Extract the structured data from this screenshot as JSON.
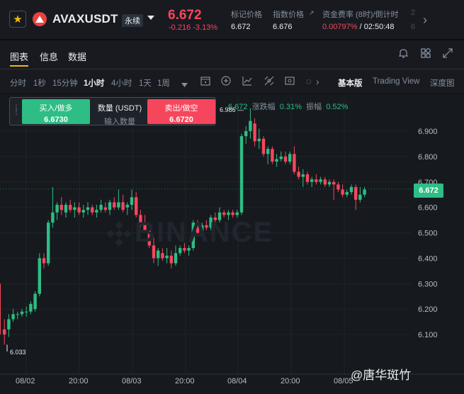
{
  "header": {
    "symbol": "AVAXUSDT",
    "contract_tag": "永续",
    "price": "6.672",
    "change": "-0.216 -3.13%",
    "mark_price_label": "标记价格",
    "mark_price": "6.672",
    "index_price_label": "指数价格",
    "index_price": "6.676",
    "funding_label": "资金费率 (8时)/倒计时",
    "funding_rate": "0.00797%",
    "countdown": "/ 02:50:48",
    "cut_label": "2",
    "cut_value": "6",
    "star_icon": "star-icon",
    "next_icon": "chevron-right-icon"
  },
  "tabs": {
    "chart": "图表",
    "info": "信息",
    "data": "数据"
  },
  "intervals": [
    "分时",
    "1秒",
    "15分钟",
    "1小时",
    "4小时",
    "1天",
    "1周"
  ],
  "active_interval": "1小时",
  "views": {
    "basic": "基本版",
    "trading_view": "Trading View",
    "depth": "深度图"
  },
  "order_widget": {
    "buy_label": "买入/做多",
    "buy_price": "6.6730",
    "qty_label": "数量 (USDT)",
    "qty_placeholder": "输入数量",
    "sell_label": "卖出/做空",
    "sell_price": "6.6720"
  },
  "legend": {
    "close": "6.672",
    "change_label": "涨跌幅",
    "change_value": "0.31%",
    "amp_label": "振幅",
    "amp_value": "0.52%"
  },
  "chart_data": {
    "type": "candlestick",
    "x_labels": [
      "08/02",
      "20:00",
      "08/03",
      "20:00",
      "08/04",
      "20:00",
      "08/05"
    ],
    "y_ticks": [
      "6.900",
      "6.800",
      "6.700",
      "6.600",
      "6.500",
      "6.400",
      "6.300",
      "6.200",
      "6.100"
    ],
    "ylim": [
      6.02,
      6.98
    ],
    "high_marker": "6.986",
    "low_marker": "6.033",
    "last_price": "6.672",
    "watermark": "BINANCE",
    "candles": [
      {
        "o": 6.12,
        "h": 6.16,
        "l": 6.06,
        "c": 6.1
      },
      {
        "o": 6.12,
        "h": 6.18,
        "l": 6.09,
        "c": 6.16
      },
      {
        "o": 6.16,
        "h": 6.2,
        "l": 6.15,
        "c": 6.18
      },
      {
        "o": 6.18,
        "h": 6.19,
        "l": 6.16,
        "c": 6.18
      },
      {
        "o": 6.18,
        "h": 6.2,
        "l": 6.17,
        "c": 6.19
      },
      {
        "o": 6.19,
        "h": 6.21,
        "l": 6.17,
        "c": 6.19
      },
      {
        "o": 6.19,
        "h": 6.23,
        "l": 6.18,
        "c": 6.22
      },
      {
        "o": 6.2,
        "h": 6.27,
        "l": 6.19,
        "c": 6.26
      },
      {
        "o": 6.26,
        "h": 6.42,
        "l": 6.25,
        "c": 6.4
      },
      {
        "o": 6.4,
        "h": 6.42,
        "l": 6.36,
        "c": 6.38
      },
      {
        "o": 6.38,
        "h": 6.55,
        "l": 6.37,
        "c": 6.54
      },
      {
        "o": 6.54,
        "h": 6.68,
        "l": 6.52,
        "c": 6.58
      },
      {
        "o": 6.58,
        "h": 6.62,
        "l": 6.55,
        "c": 6.61
      },
      {
        "o": 6.61,
        "h": 6.64,
        "l": 6.57,
        "c": 6.59
      },
      {
        "o": 6.58,
        "h": 6.62,
        "l": 6.56,
        "c": 6.61
      },
      {
        "o": 6.61,
        "h": 6.63,
        "l": 6.58,
        "c": 6.59
      },
      {
        "o": 6.59,
        "h": 6.62,
        "l": 6.56,
        "c": 6.6
      },
      {
        "o": 6.6,
        "h": 6.62,
        "l": 6.57,
        "c": 6.58
      },
      {
        "o": 6.58,
        "h": 6.61,
        "l": 6.56,
        "c": 6.59
      },
      {
        "o": 6.59,
        "h": 6.62,
        "l": 6.57,
        "c": 6.6
      },
      {
        "o": 6.6,
        "h": 6.61,
        "l": 6.57,
        "c": 6.58
      },
      {
        "o": 6.58,
        "h": 6.61,
        "l": 6.56,
        "c": 6.59
      },
      {
        "o": 6.59,
        "h": 6.63,
        "l": 6.58,
        "c": 6.61
      },
      {
        "o": 6.6,
        "h": 6.62,
        "l": 6.58,
        "c": 6.59
      },
      {
        "o": 6.59,
        "h": 6.63,
        "l": 6.57,
        "c": 6.62
      },
      {
        "o": 6.62,
        "h": 6.64,
        "l": 6.59,
        "c": 6.6
      },
      {
        "o": 6.6,
        "h": 6.67,
        "l": 6.59,
        "c": 6.62
      },
      {
        "o": 6.62,
        "h": 6.65,
        "l": 6.58,
        "c": 6.59
      },
      {
        "o": 6.6,
        "h": 6.62,
        "l": 6.57,
        "c": 6.61
      },
      {
        "o": 6.61,
        "h": 6.67,
        "l": 6.59,
        "c": 6.64
      },
      {
        "o": 6.64,
        "h": 6.66,
        "l": 6.56,
        "c": 6.57
      },
      {
        "o": 6.57,
        "h": 6.59,
        "l": 6.52,
        "c": 6.53
      },
      {
        "o": 6.54,
        "h": 6.57,
        "l": 6.51,
        "c": 6.51
      },
      {
        "o": 6.51,
        "h": 6.53,
        "l": 6.44,
        "c": 6.45
      },
      {
        "o": 6.45,
        "h": 6.48,
        "l": 6.38,
        "c": 6.4
      },
      {
        "o": 6.4,
        "h": 6.44,
        "l": 6.37,
        "c": 6.43
      },
      {
        "o": 6.42,
        "h": 6.44,
        "l": 6.39,
        "c": 6.4
      },
      {
        "o": 6.4,
        "h": 6.44,
        "l": 6.38,
        "c": 6.41
      },
      {
        "o": 6.41,
        "h": 6.43,
        "l": 6.36,
        "c": 6.38
      },
      {
        "o": 6.38,
        "h": 6.45,
        "l": 6.37,
        "c": 6.42
      },
      {
        "o": 6.42,
        "h": 6.45,
        "l": 6.41,
        "c": 6.44
      },
      {
        "o": 6.44,
        "h": 6.46,
        "l": 6.42,
        "c": 6.43
      },
      {
        "o": 6.43,
        "h": 6.45,
        "l": 6.41,
        "c": 6.44
      },
      {
        "o": 6.44,
        "h": 6.55,
        "l": 6.43,
        "c": 6.54
      },
      {
        "o": 6.54,
        "h": 6.55,
        "l": 6.49,
        "c": 6.5
      },
      {
        "o": 6.5,
        "h": 6.54,
        "l": 6.49,
        "c": 6.53
      },
      {
        "o": 6.53,
        "h": 6.55,
        "l": 6.51,
        "c": 6.52
      },
      {
        "o": 6.52,
        "h": 6.57,
        "l": 6.51,
        "c": 6.56
      },
      {
        "o": 6.56,
        "h": 6.58,
        "l": 6.53,
        "c": 6.55
      },
      {
        "o": 6.55,
        "h": 6.6,
        "l": 6.54,
        "c": 6.58
      },
      {
        "o": 6.58,
        "h": 6.59,
        "l": 6.56,
        "c": 6.57
      },
      {
        "o": 6.57,
        "h": 6.59,
        "l": 6.55,
        "c": 6.58
      },
      {
        "o": 6.58,
        "h": 6.59,
        "l": 6.56,
        "c": 6.57
      },
      {
        "o": 6.57,
        "h": 6.59,
        "l": 6.56,
        "c": 6.58
      },
      {
        "o": 6.58,
        "h": 6.89,
        "l": 6.57,
        "c": 6.88
      },
      {
        "o": 6.88,
        "h": 6.92,
        "l": 6.85,
        "c": 6.9
      },
      {
        "o": 6.9,
        "h": 6.99,
        "l": 6.87,
        "c": 6.94
      },
      {
        "o": 6.93,
        "h": 6.95,
        "l": 6.84,
        "c": 6.86
      },
      {
        "o": 6.86,
        "h": 6.91,
        "l": 6.83,
        "c": 6.87
      },
      {
        "o": 6.87,
        "h": 6.88,
        "l": 6.8,
        "c": 6.81
      },
      {
        "o": 6.81,
        "h": 6.84,
        "l": 6.77,
        "c": 6.83
      },
      {
        "o": 6.83,
        "h": 6.84,
        "l": 6.77,
        "c": 6.78
      },
      {
        "o": 6.78,
        "h": 6.81,
        "l": 6.76,
        "c": 6.79
      },
      {
        "o": 6.79,
        "h": 6.82,
        "l": 6.78,
        "c": 6.8
      },
      {
        "o": 6.8,
        "h": 6.82,
        "l": 6.77,
        "c": 6.78
      },
      {
        "o": 6.78,
        "h": 6.82,
        "l": 6.77,
        "c": 6.81
      },
      {
        "o": 6.81,
        "h": 6.84,
        "l": 6.73,
        "c": 6.74
      },
      {
        "o": 6.74,
        "h": 6.76,
        "l": 6.71,
        "c": 6.72
      },
      {
        "o": 6.72,
        "h": 6.75,
        "l": 6.68,
        "c": 6.73
      },
      {
        "o": 6.73,
        "h": 6.74,
        "l": 6.69,
        "c": 6.7
      },
      {
        "o": 6.7,
        "h": 6.72,
        "l": 6.68,
        "c": 6.71
      },
      {
        "o": 6.71,
        "h": 6.73,
        "l": 6.69,
        "c": 6.7
      },
      {
        "o": 6.7,
        "h": 6.72,
        "l": 6.69,
        "c": 6.71
      },
      {
        "o": 6.71,
        "h": 6.72,
        "l": 6.68,
        "c": 6.69
      },
      {
        "o": 6.69,
        "h": 6.71,
        "l": 6.68,
        "c": 6.7
      },
      {
        "o": 6.7,
        "h": 6.71,
        "l": 6.63,
        "c": 6.69
      },
      {
        "o": 6.69,
        "h": 6.7,
        "l": 6.66,
        "c": 6.67
      },
      {
        "o": 6.67,
        "h": 6.69,
        "l": 6.64,
        "c": 6.65
      },
      {
        "o": 6.65,
        "h": 6.67,
        "l": 6.64,
        "c": 6.66
      },
      {
        "o": 6.66,
        "h": 6.69,
        "l": 6.65,
        "c": 6.68
      },
      {
        "o": 6.68,
        "h": 6.69,
        "l": 6.59,
        "c": 6.63
      },
      {
        "o": 6.63,
        "h": 6.68,
        "l": 6.62,
        "c": 6.65
      },
      {
        "o": 6.65,
        "h": 6.68,
        "l": 6.64,
        "c": 6.67
      }
    ]
  },
  "footer_watermark": "@唐华斑竹",
  "colors": {
    "up": "#2ebd85",
    "down": "#f6465d",
    "accent": "#f0b90b",
    "bg": "#161a1e"
  }
}
